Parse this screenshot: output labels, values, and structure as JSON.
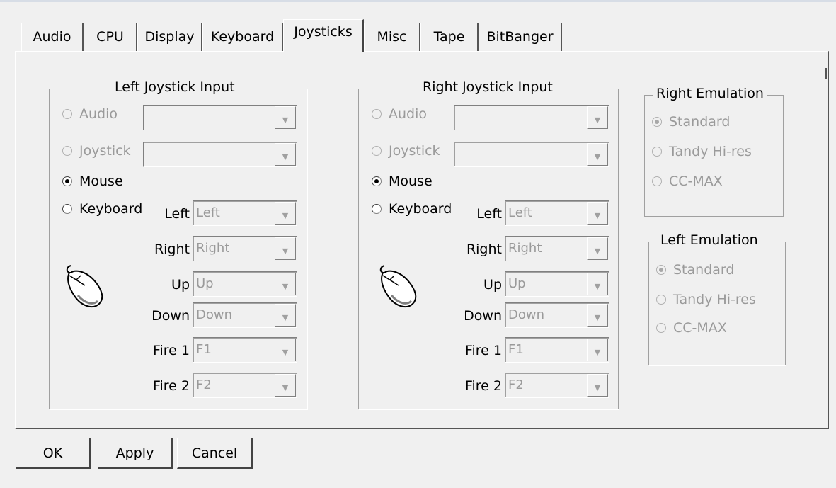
{
  "tabs": [
    {
      "label": "Audio",
      "active": false
    },
    {
      "label": "CPU",
      "active": false
    },
    {
      "label": "Display",
      "active": false
    },
    {
      "label": "Keyboard",
      "active": false
    },
    {
      "label": "Joysticks",
      "active": true
    },
    {
      "label": "Misc",
      "active": false
    },
    {
      "label": "Tape",
      "active": false
    },
    {
      "label": "BitBanger",
      "active": false
    }
  ],
  "left_joystick": {
    "title": "Left Joystick Input",
    "audio_label": "Audio",
    "joystick_label": "Joystick",
    "mouse_label": "Mouse",
    "keyboard_label": "Keyboard",
    "selected": "Mouse",
    "audio_value": "",
    "joystick_value": "",
    "mappings": [
      {
        "label": "Left",
        "value": "Left"
      },
      {
        "label": "Right",
        "value": "Right"
      },
      {
        "label": "Up",
        "value": "Up"
      },
      {
        "label": "Down",
        "value": "Down"
      },
      {
        "label": "Fire 1",
        "value": "F1"
      },
      {
        "label": "Fire 2",
        "value": "F2"
      }
    ]
  },
  "right_joystick": {
    "title": "Right Joystick Input",
    "audio_label": "Audio",
    "joystick_label": "Joystick",
    "mouse_label": "Mouse",
    "keyboard_label": "Keyboard",
    "selected": "Mouse",
    "audio_value": "",
    "joystick_value": "",
    "mappings": [
      {
        "label": "Left",
        "value": "Left"
      },
      {
        "label": "Right",
        "value": "Right"
      },
      {
        "label": "Up",
        "value": "Up"
      },
      {
        "label": "Down",
        "value": "Down"
      },
      {
        "label": "Fire 1",
        "value": "F1"
      },
      {
        "label": "Fire 2",
        "value": "F2"
      }
    ]
  },
  "right_emulation": {
    "title": "Right Emulation",
    "options": [
      "Standard",
      "Tandy Hi-res",
      "CC-MAX"
    ],
    "selected": "Standard"
  },
  "left_emulation": {
    "title": "Left Emulation",
    "options": [
      "Standard",
      "Tandy Hi-res",
      "CC-MAX"
    ],
    "selected": "Standard"
  },
  "buttons": {
    "ok": "OK",
    "apply": "Apply",
    "cancel": "Cancel"
  },
  "icons": {
    "combo_arrow": "chevron-down-icon",
    "mouse": "mouse-icon"
  },
  "colors": {
    "window_bg": "#f0f0f0",
    "disabled_text": "#9a9a9a"
  }
}
